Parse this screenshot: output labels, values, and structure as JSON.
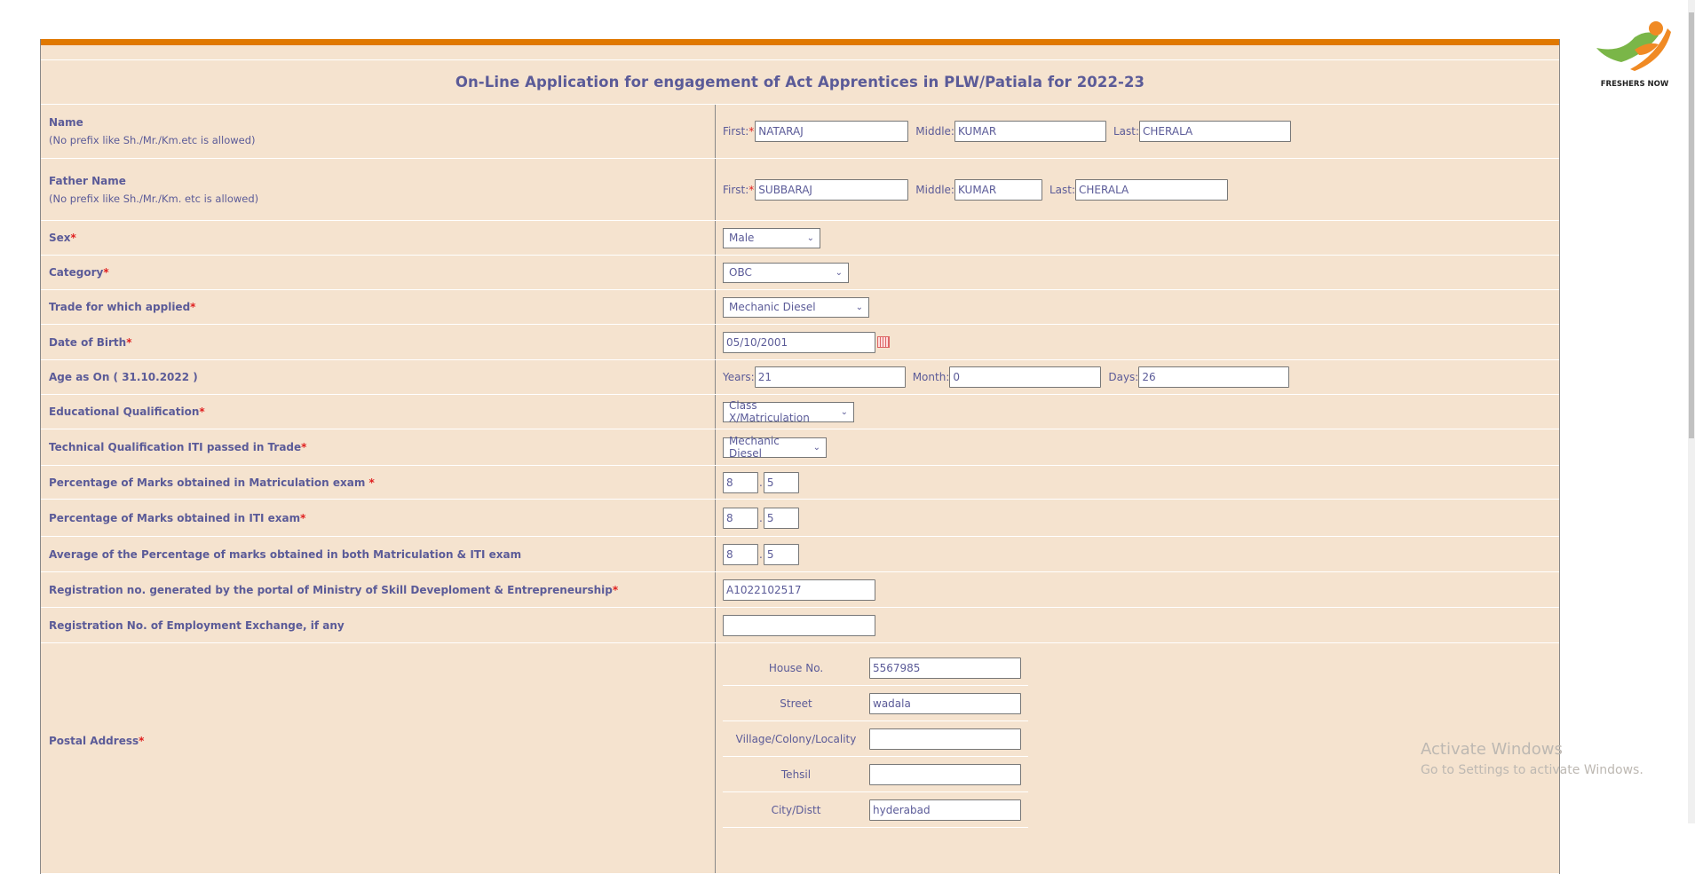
{
  "title": "On-Line Application for engagement of Act Apprentices in PLW/Patiala for 2022-23",
  "logo": {
    "text": "FRESHERS NOW",
    "colors": [
      "#7ab648",
      "#f08a24"
    ]
  },
  "name": {
    "label": "Name",
    "hint": "(No prefix like Sh./Mr./Km.etc is allowed)",
    "first_label": "First:",
    "middle_label": "Middle:",
    "last_label": "Last:",
    "first": "NATARAJ",
    "middle": "KUMAR",
    "last": "CHERALA"
  },
  "father": {
    "label": "Father Name",
    "hint": "(No prefix like Sh./Mr./Km. etc is allowed)",
    "first_label": "First:",
    "middle_label": "Middle:",
    "last_label": "Last:",
    "first": "SUBBARAJ",
    "middle": "KUMAR",
    "last": "CHERALA"
  },
  "sex": {
    "label": "Sex",
    "value": "Male"
  },
  "category": {
    "label": "Category",
    "value": "OBC"
  },
  "trade": {
    "label": "Trade for which applied",
    "value": "Mechanic Diesel"
  },
  "dob": {
    "label": "Date of Birth",
    "value": "05/10/2001"
  },
  "age": {
    "label": "Age as On ( 31.10.2022 )",
    "years_label": "Years:",
    "month_label": "Month:",
    "days_label": "Days:",
    "years": "21",
    "month": "0",
    "days": "26"
  },
  "edu": {
    "label": "Educational Qualification",
    "value": "Class X/Matriculation"
  },
  "tech": {
    "label": "Technical Qualification ITI passed in Trade",
    "value": "Mechanic Diesel"
  },
  "matric_pct": {
    "label": "Percentage of Marks obtained in Matriculation exam ",
    "int": "8",
    "dec": "5"
  },
  "iti_pct": {
    "label": "Percentage of Marks obtained in ITI exam",
    "int": "8",
    "dec": "5"
  },
  "avg_pct": {
    "label": "Average of the Percentage of marks obtained in both Matriculation & ITI exam",
    "int": "8",
    "dec": "5"
  },
  "reg_msde": {
    "label": "Registration no. generated by the portal of Ministry of Skill Deveploment & Entrepreneurship",
    "value": "A1022102517"
  },
  "reg_emp": {
    "label": "Registration No. of Employment Exchange, if any",
    "value": ""
  },
  "address": {
    "label": "Postal Address",
    "fields": [
      {
        "label": "House No.",
        "value": "5567985"
      },
      {
        "label": "Street",
        "value": "wadala"
      },
      {
        "label": "Village/Colony/Locality",
        "value": ""
      },
      {
        "label": "Tehsil",
        "value": ""
      },
      {
        "label": "City/Distt",
        "value": "hyderabad"
      }
    ]
  },
  "required_mark": "*",
  "dot": ".",
  "watermark": {
    "title": "Activate Windows",
    "sub": "Go to Settings to activate Windows."
  }
}
